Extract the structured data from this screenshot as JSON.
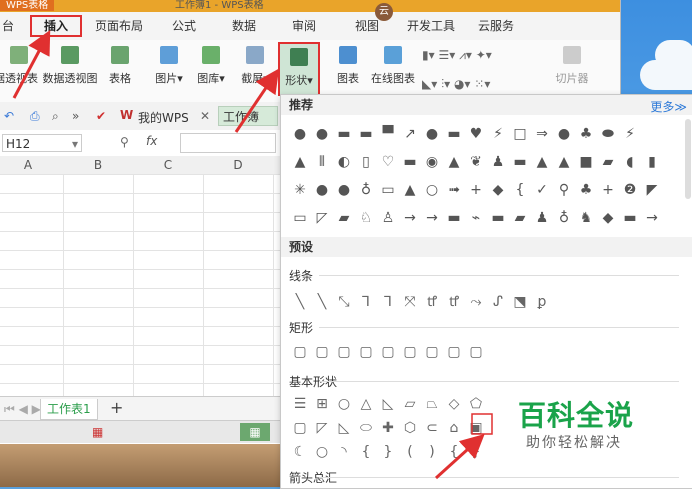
{
  "window": {
    "app_label": "WPS表格",
    "title_text": "工作簿1 - WPS表格"
  },
  "tabs": [
    {
      "label": "台"
    },
    {
      "label": "插入"
    },
    {
      "label": "页面布局"
    },
    {
      "label": "公式"
    },
    {
      "label": "数据"
    },
    {
      "label": "审阅"
    },
    {
      "label": "视图"
    },
    {
      "label": "开发工具"
    },
    {
      "label": "云服务"
    }
  ],
  "user_badge": "云",
  "ribbon": {
    "pivot_table": "数据透视表",
    "pivot_view": "数据透视图",
    "table": "表格",
    "picture": "图片",
    "gallery": "图库",
    "screenshot": "截屏",
    "shape": "形状",
    "chart": "图表",
    "online_chart": "在线图表",
    "slicer": "切片器"
  },
  "toolbar2": {
    "my_wps": "我的WPS",
    "workbook_tab": "工作簿"
  },
  "formula": {
    "namebox": "H12",
    "fx": "fx"
  },
  "columns": [
    "A",
    "B",
    "C",
    "D"
  ],
  "sheet": {
    "tab": "工作表1",
    "add": "+"
  },
  "panel": {
    "recommended": "推荐",
    "more": "更多≫",
    "presets": "预设",
    "lines": "线条",
    "rectangles": "矩形",
    "basic_shapes": "基本形状",
    "block_arrows": "箭头总汇"
  },
  "shapes": {
    "rec1": "●●▬▬▀↗●▬♥⚡□⇒●♣⬬⚡",
    "rec2": "▲⦀◐▯♡▬◉▲❦♟▬▲▲■▰◖▮",
    "rec3": "✳●●♁▭▲○➟+◆{✓⚲♣+❷◤",
    "rec4": "▭◸▰♘♙→→▬⌁▬▰♟♁♞◆▬→",
    "lines": "╲╲⤡⅂⅂⤧ꝷꝷ⤳ᔑ⬔ꝑ",
    "rects": "▢▢▢▢▢▢▢▢▢",
    "basic1": "☰⊞○△◺▱⏢◇⬠",
    "basic2": "▢◸◺⬭✚⬡⊂⌂▣",
    "basic3": "☾○◝{}(){}"
  },
  "watermark": {
    "brand": "百科全说",
    "slogan": "助你轻松解决"
  }
}
